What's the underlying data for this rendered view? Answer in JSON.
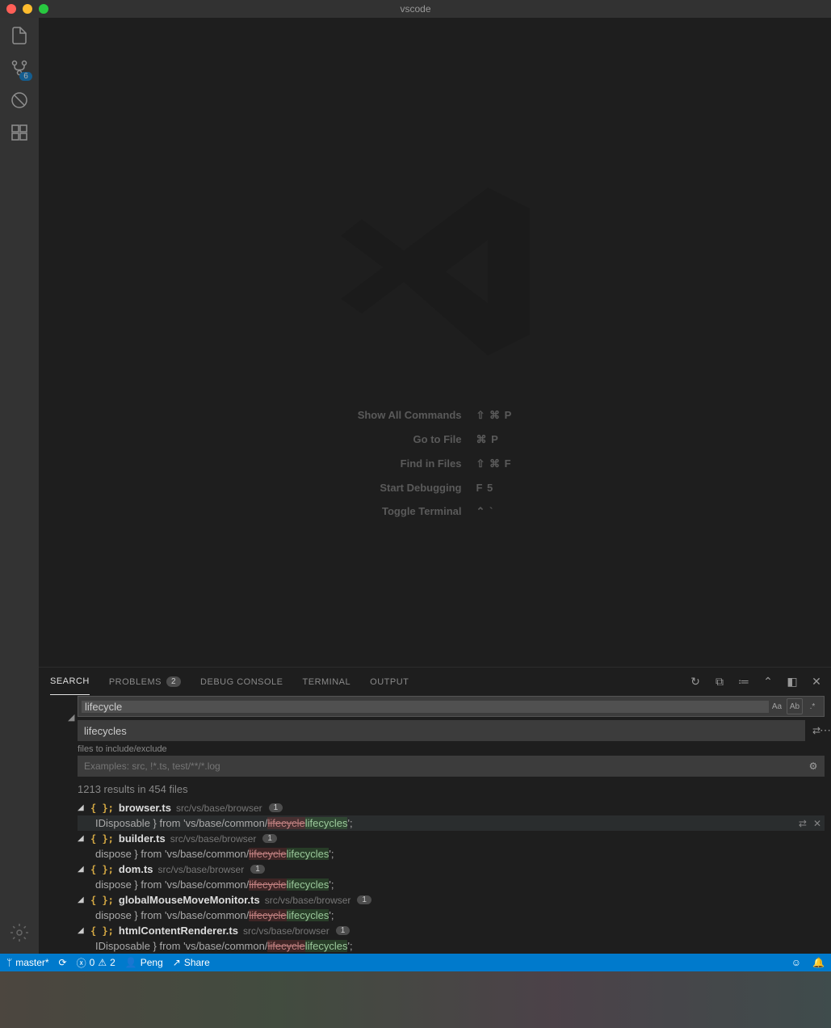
{
  "titlebar": {
    "title": "vscode"
  },
  "activityBar": {
    "scmBadge": "6"
  },
  "watermark": {
    "tips": [
      {
        "label": "Show All Commands",
        "key": "⇧ ⌘ P"
      },
      {
        "label": "Go to File",
        "key": "⌘ P"
      },
      {
        "label": "Find in Files",
        "key": "⇧ ⌘ F"
      },
      {
        "label": "Start Debugging",
        "key": "F 5"
      },
      {
        "label": "Toggle Terminal",
        "key": "⌃ `"
      }
    ]
  },
  "panel": {
    "tabs": {
      "search": "SEARCH",
      "problems": "PROBLEMS",
      "problemsBadge": "2",
      "debugConsole": "DEBUG CONSOLE",
      "terminal": "TERMINAL",
      "output": "OUTPUT"
    },
    "search": {
      "searchValue": "lifecycle",
      "replaceValue": "lifecycles",
      "includeLabel": "files to include/exclude",
      "includePlaceholder": "Examples: src, !*.ts, test/**/*.log",
      "resultsSummary": "1213 results in 454 files",
      "inputFlags": {
        "case": "Aa",
        "word": "Ab",
        "regex": ".*"
      },
      "files": [
        {
          "name": "browser.ts",
          "path": "src/vs/base/browser",
          "count": "1",
          "lines": [
            {
              "pre": "IDisposable } from 'vs/base/common/",
              "old": "lifecycle",
              "new": "lifecycles",
              "post": "';",
              "hover": true
            }
          ]
        },
        {
          "name": "builder.ts",
          "path": "src/vs/base/browser",
          "count": "1",
          "lines": [
            {
              "pre": "dispose } from 'vs/base/common/",
              "old": "lifecycle",
              "new": "lifecycles",
              "post": "';"
            }
          ]
        },
        {
          "name": "dom.ts",
          "path": "src/vs/base/browser",
          "count": "1",
          "lines": [
            {
              "pre": "dispose } from 'vs/base/common/",
              "old": "lifecycle",
              "new": "lifecycles",
              "post": "';"
            }
          ]
        },
        {
          "name": "globalMouseMoveMonitor.ts",
          "path": "src/vs/base/browser",
          "count": "1",
          "lines": [
            {
              "pre": "dispose } from 'vs/base/common/",
              "old": "lifecycle",
              "new": "lifecycles",
              "post": "';"
            }
          ]
        },
        {
          "name": "htmlContentRenderer.ts",
          "path": "src/vs/base/browser",
          "count": "1",
          "lines": [
            {
              "pre": "IDisposable } from 'vs/base/common/",
              "old": "lifecycle",
              "new": "lifecycles",
              "post": "';"
            }
          ]
        }
      ]
    }
  },
  "statusbar": {
    "branch": "master*",
    "errors": "0",
    "warnings": "2",
    "user": "Peng",
    "share": "Share"
  }
}
